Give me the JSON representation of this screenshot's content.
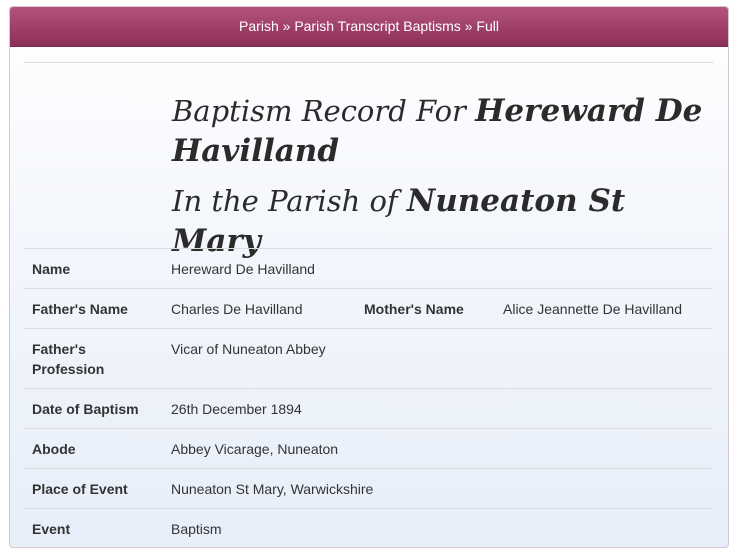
{
  "breadcrumb": {
    "item1": "Parish",
    "sep1": " » ",
    "item2": "Parish Transcript Baptisms",
    "sep2": " » ",
    "item3": "Full"
  },
  "title": {
    "prefix": "Baptism Record For ",
    "person": "Hereward De Havilland",
    "parish_prefix": "In the Parish of ",
    "parish": "Nuneaton St Mary"
  },
  "record": {
    "name_label": "Name",
    "name_value": "Hereward De Havilland",
    "father_label": "Father's Name",
    "father_value": "Charles De Havilland",
    "mother_label": "Mother's Name",
    "mother_value": "Alice Jeannette De Havilland",
    "profession_label": "Father's Profession",
    "profession_value": "Vicar of Nuneaton Abbey",
    "date_label": "Date of Baptism",
    "date_value": "26th December 1894",
    "abode_label": "Abode",
    "abode_value": "Abbey Vicarage, Nuneaton",
    "place_label": "Place of Event",
    "place_value": "Nuneaton St Mary, Warwickshire",
    "event_label": "Event",
    "event_value": "Baptism"
  }
}
